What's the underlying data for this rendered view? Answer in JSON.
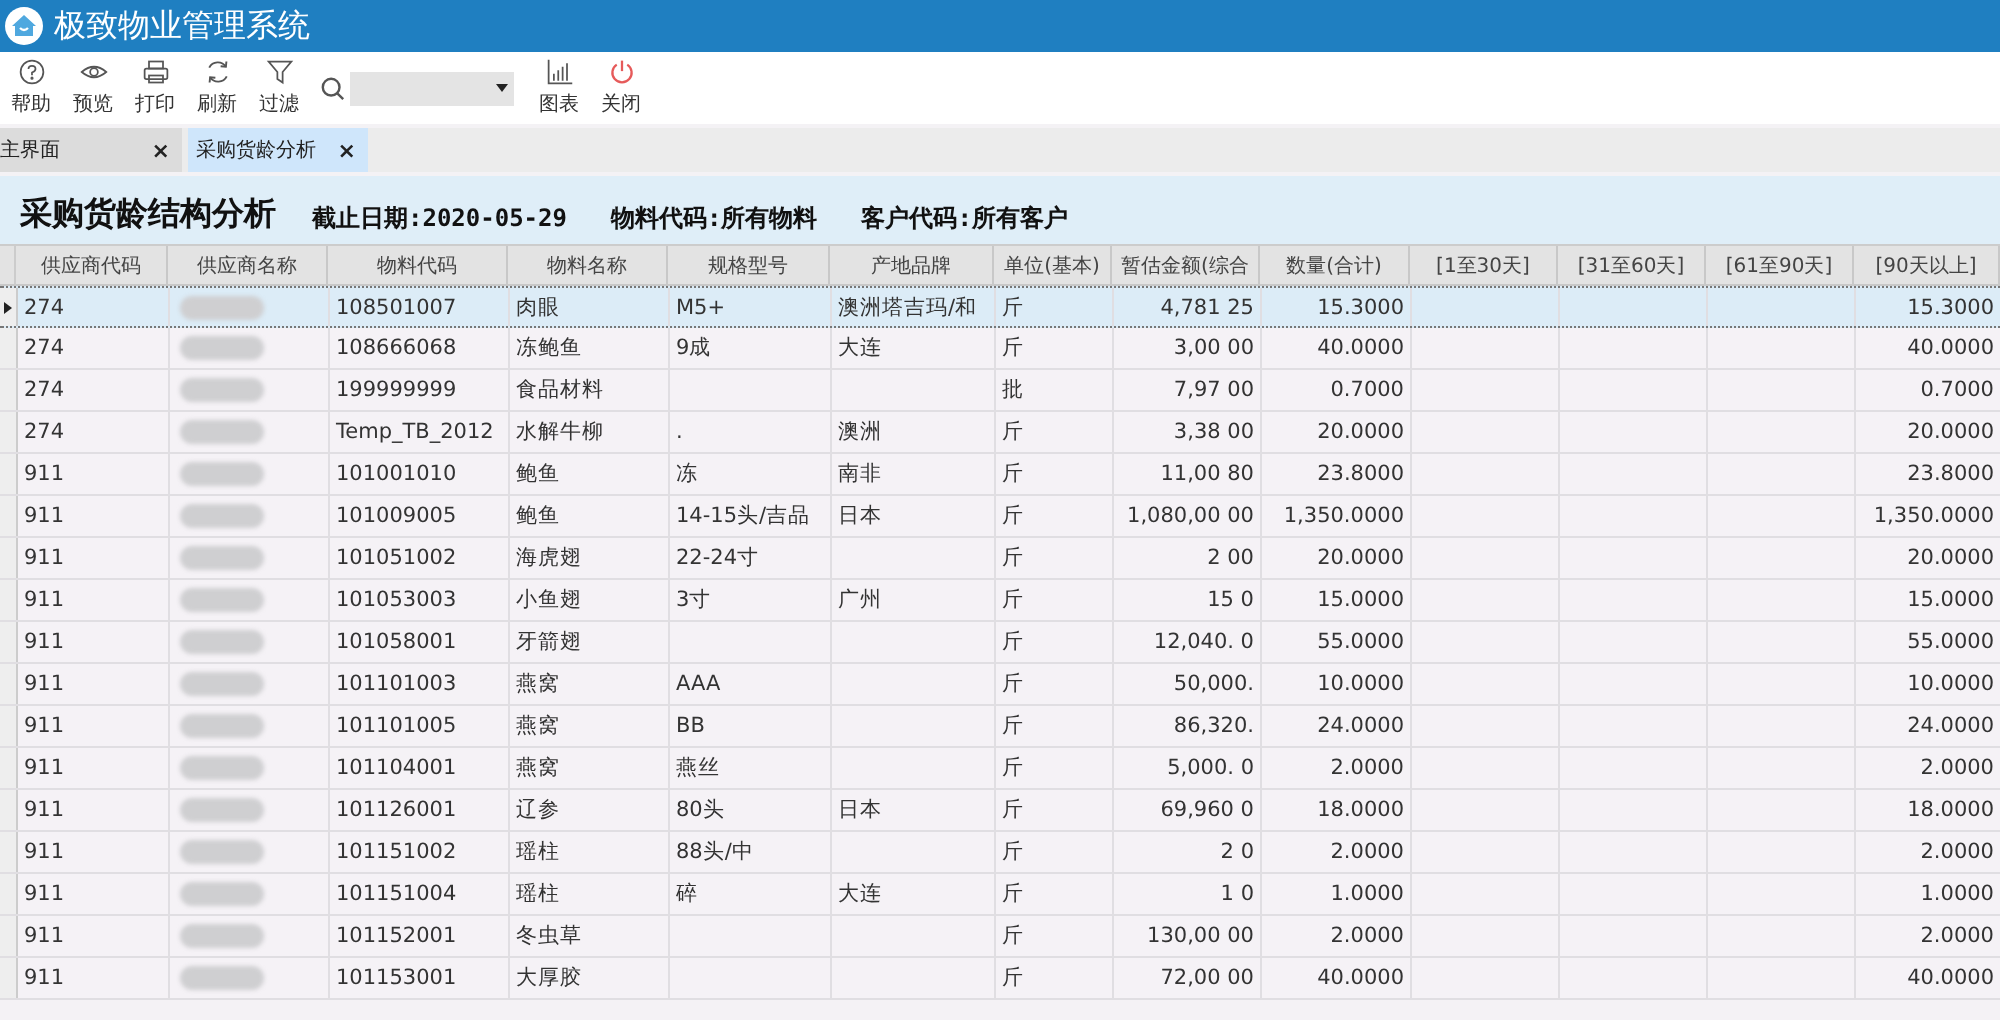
{
  "window": {
    "title": "极致物业管理系统"
  },
  "toolbar": {
    "items": [
      {
        "kind": "help",
        "label": "帮助"
      },
      {
        "kind": "preview",
        "label": "预览"
      },
      {
        "kind": "print",
        "label": "打印"
      },
      {
        "kind": "refresh",
        "label": "刷新"
      },
      {
        "kind": "filter",
        "label": "过滤"
      },
      {
        "kind": "search"
      },
      {
        "kind": "chart",
        "label": "图表"
      },
      {
        "kind": "power",
        "label": "关闭"
      }
    ]
  },
  "tabs": [
    {
      "label": "主界面",
      "selected": false,
      "close": "×"
    },
    {
      "label": "采购货龄分析",
      "selected": true,
      "close": "×"
    }
  ],
  "report": {
    "title": "采购货龄结构分析",
    "filters": [
      "截止日期:2020-05-29",
      "物料代码:所有物料",
      "客户代码:所有客户"
    ]
  },
  "table": {
    "columns": [
      {
        "label": "供应商代码",
        "kind": "text"
      },
      {
        "label": "供应商名称",
        "kind": "blurred"
      },
      {
        "label": "物料代码",
        "kind": "text"
      },
      {
        "label": "物料名称",
        "kind": "text"
      },
      {
        "label": "规格型号",
        "kind": "text"
      },
      {
        "label": "产地品牌",
        "kind": "text"
      },
      {
        "label": "单位(基本)",
        "kind": "text"
      },
      {
        "label": "暂估金额(综合",
        "kind": "number"
      },
      {
        "label": "数量(合计)",
        "kind": "number"
      },
      {
        "label": "[1至30天]",
        "kind": "number"
      },
      {
        "label": "[31至60天]",
        "kind": "number"
      },
      {
        "label": "[61至90天]",
        "kind": "number"
      },
      {
        "label": "[90天以上]",
        "kind": "number"
      }
    ],
    "rows": [
      {
        "selected": true,
        "cells": [
          "274",
          null,
          "108501007",
          "肉眼",
          "M5+",
          "澳洲塔吉玛/和",
          "斤",
          "4,781 25",
          "15.3000",
          null,
          null,
          null,
          "15.3000"
        ]
      },
      {
        "selected": false,
        "cells": [
          "274",
          null,
          "108666068",
          "冻鲍鱼",
          "9成",
          "大连",
          "斤",
          "3,00 00",
          "40.0000",
          null,
          null,
          null,
          "40.0000"
        ]
      },
      {
        "selected": false,
        "cells": [
          "274",
          null,
          "199999999",
          "食品材料",
          null,
          null,
          "批",
          "7,97 00",
          "0.7000",
          null,
          null,
          null,
          "0.7000"
        ]
      },
      {
        "selected": false,
        "cells": [
          "274",
          null,
          "Temp_TB_2012",
          "水解牛柳",
          ".",
          "澳洲",
          "斤",
          "3,38 00",
          "20.0000",
          null,
          null,
          null,
          "20.0000"
        ]
      },
      {
        "selected": false,
        "cells": [
          "911",
          null,
          "101001010",
          "鲍鱼",
          "冻",
          "南非",
          "斤",
          "11,00 80",
          "23.8000",
          null,
          null,
          null,
          "23.8000"
        ]
      },
      {
        "selected": false,
        "cells": [
          "911",
          null,
          "101009005",
          "鲍鱼",
          "14-15头/吉品",
          "日本",
          "斤",
          "1,080,00 00",
          "1,350.0000",
          null,
          null,
          null,
          "1,350.0000"
        ]
      },
      {
        "selected": false,
        "cells": [
          "911",
          null,
          "101051002",
          "海虎翅",
          "22-24寸",
          null,
          "斤",
          "2 00",
          "20.0000",
          null,
          null,
          null,
          "20.0000"
        ]
      },
      {
        "selected": false,
        "cells": [
          "911",
          null,
          "101053003",
          "小鱼翅",
          "3寸",
          "广州",
          "斤",
          "15 0",
          "15.0000",
          null,
          null,
          null,
          "15.0000"
        ]
      },
      {
        "selected": false,
        "cells": [
          "911",
          null,
          "101058001",
          "牙箭翅",
          null,
          null,
          "斤",
          "12,040. 0",
          "55.0000",
          null,
          null,
          null,
          "55.0000"
        ]
      },
      {
        "selected": false,
        "cells": [
          "911",
          null,
          "101101003",
          "燕窝",
          "AAA",
          null,
          "斤",
          "50,000.",
          "10.0000",
          null,
          null,
          null,
          "10.0000"
        ]
      },
      {
        "selected": false,
        "cells": [
          "911",
          null,
          "101101005",
          "燕窝",
          "BB",
          null,
          "斤",
          "86,320.",
          "24.0000",
          null,
          null,
          null,
          "24.0000"
        ]
      },
      {
        "selected": false,
        "cells": [
          "911",
          null,
          "101104001",
          "燕窝",
          "燕丝",
          null,
          "斤",
          "5,000. 0",
          "2.0000",
          null,
          null,
          null,
          "2.0000"
        ]
      },
      {
        "selected": false,
        "cells": [
          "911",
          null,
          "101126001",
          "辽参",
          "80头",
          "日本",
          "斤",
          "69,960 0",
          "18.0000",
          null,
          null,
          null,
          "18.0000"
        ]
      },
      {
        "selected": false,
        "cells": [
          "911",
          null,
          "101151002",
          "瑶柱",
          "88头/中",
          null,
          "斤",
          "2 0",
          "2.0000",
          null,
          null,
          null,
          "2.0000"
        ]
      },
      {
        "selected": false,
        "cells": [
          "911",
          null,
          "101151004",
          "瑶柱",
          "碎",
          "大连",
          "斤",
          "1 0",
          "1.0000",
          null,
          null,
          null,
          "1.0000"
        ]
      },
      {
        "selected": false,
        "cells": [
          "911",
          null,
          "101152001",
          "冬虫草",
          null,
          null,
          "斤",
          "130,00 00",
          "2.0000",
          null,
          null,
          null,
          "2.0000"
        ]
      },
      {
        "selected": false,
        "cells": [
          "911",
          null,
          "101153001",
          "大厚胶",
          null,
          null,
          "斤",
          "72,00 00",
          "40.0000",
          null,
          null,
          null,
          "40.0000"
        ]
      }
    ]
  }
}
